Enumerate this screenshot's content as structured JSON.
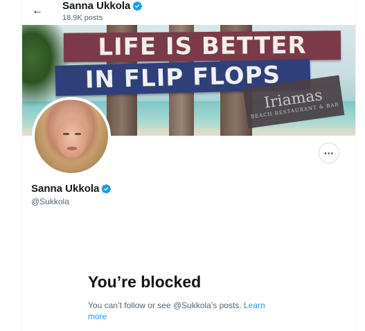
{
  "header": {
    "back_label": "←",
    "name": "Sanna Ukkola",
    "post_count": "18.9K posts"
  },
  "banner": {
    "sign_top": "LIFE IS BETTER",
    "sign_bottom": "IN FLIP FLOPS",
    "sign_small": "Iriamas",
    "sign_small_sub": "BEACH RESTAURANT & BAR"
  },
  "profile": {
    "name": "Sanna Ukkola",
    "handle": "@Sukkola",
    "more_label": "···"
  },
  "blocked": {
    "title": "You’re blocked",
    "message": "You can’t follow or see @Sukkola’s posts.",
    "link": "Learn more"
  },
  "colors": {
    "verified": "#1d9bf0",
    "link": "#1d9bf0",
    "secondary_text": "#536471"
  },
  "icons": {
    "back": "arrow-left-icon",
    "verified": "verified-badge-icon",
    "more": "more-horizontal-icon"
  }
}
